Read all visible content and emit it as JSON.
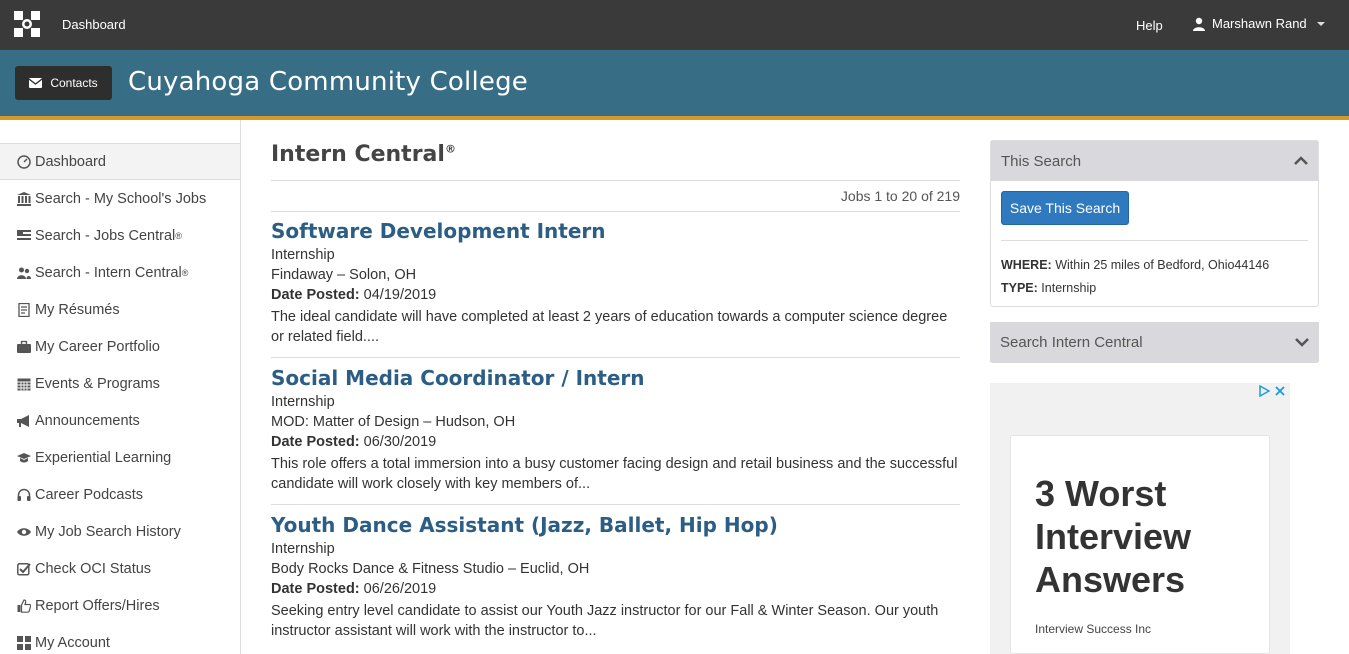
{
  "topbar": {
    "dashboard": "Dashboard",
    "help": "Help",
    "user": "Marshawn Rand"
  },
  "banner": {
    "contacts": "Contacts",
    "college": "Cuyahoga Community College"
  },
  "sidebar": {
    "items": [
      {
        "label": "Dashboard",
        "icon": "dashboard-icon"
      },
      {
        "label": "Search - My School's Jobs",
        "icon": "institution-icon"
      },
      {
        "label": "Search - Jobs Central",
        "sup": "®",
        "icon": "flag-icon"
      },
      {
        "label": "Search - Intern Central",
        "sup": "®",
        "icon": "users-icon"
      },
      {
        "label": "My Résumés",
        "icon": "document-icon"
      },
      {
        "label": "My Career Portfolio",
        "icon": "briefcase-icon"
      },
      {
        "label": "Events & Programs",
        "icon": "calendar-icon"
      },
      {
        "label": "Announcements",
        "icon": "megaphone-icon"
      },
      {
        "label": "Experiential Learning",
        "icon": "graduation-cap-icon"
      },
      {
        "label": "Career Podcasts",
        "icon": "headphones-icon"
      },
      {
        "label": "My Job Search History",
        "icon": "eye-icon"
      },
      {
        "label": "Check OCI Status",
        "icon": "check-square-icon"
      },
      {
        "label": "Report Offers/Hires",
        "icon": "thumbs-up-icon"
      },
      {
        "label": "My Account",
        "icon": "account-icon"
      }
    ]
  },
  "main": {
    "title": "Intern Central",
    "title_sup": "®",
    "jobs_count": "Jobs 1 to 20 of 219",
    "date_label": "Date Posted:",
    "jobs": [
      {
        "title": "Software Development Intern",
        "type": "Internship",
        "employer": "Findaway – Solon, OH",
        "date": "04/19/2019",
        "desc": "The ideal candidate will have completed at least 2 years of education towards a computer science degree or related field...."
      },
      {
        "title": "Social Media Coordinator / Intern",
        "type": "Internship",
        "employer": "MOD: Matter of Design – Hudson, OH",
        "date": "06/30/2019",
        "desc": "This role offers a total immersion into a busy customer facing design and retail business and the successful candidate will work closely with key members of..."
      },
      {
        "title": "Youth Dance Assistant (Jazz, Ballet, Hip Hop)",
        "type": "Internship",
        "employer": "Body Rocks Dance & Fitness Studio – Euclid, OH",
        "date": "06/26/2019",
        "desc": "Seeking entry level candidate to assist our Youth Jazz instructor for our Fall & Winter Season. Our youth instructor assistant will work with the instructor to..."
      }
    ]
  },
  "right": {
    "this_search": "This Search",
    "save_button": "Save This Search",
    "where_label": "WHERE:",
    "where_value": "Within 25 miles of Bedford, Ohio44146",
    "type_label": "TYPE:",
    "type_value": "Internship",
    "search_intern": "Search Intern Central"
  },
  "ad": {
    "headline": "3 Worst Interview Answers",
    "sponsor": "Interview Success Inc"
  },
  "colors": {
    "topbar": "#3a3a3a",
    "banner": "#376e86",
    "accent_stripe": "#d49a28",
    "link": "#2c5d84",
    "button": "#2f7abf"
  }
}
